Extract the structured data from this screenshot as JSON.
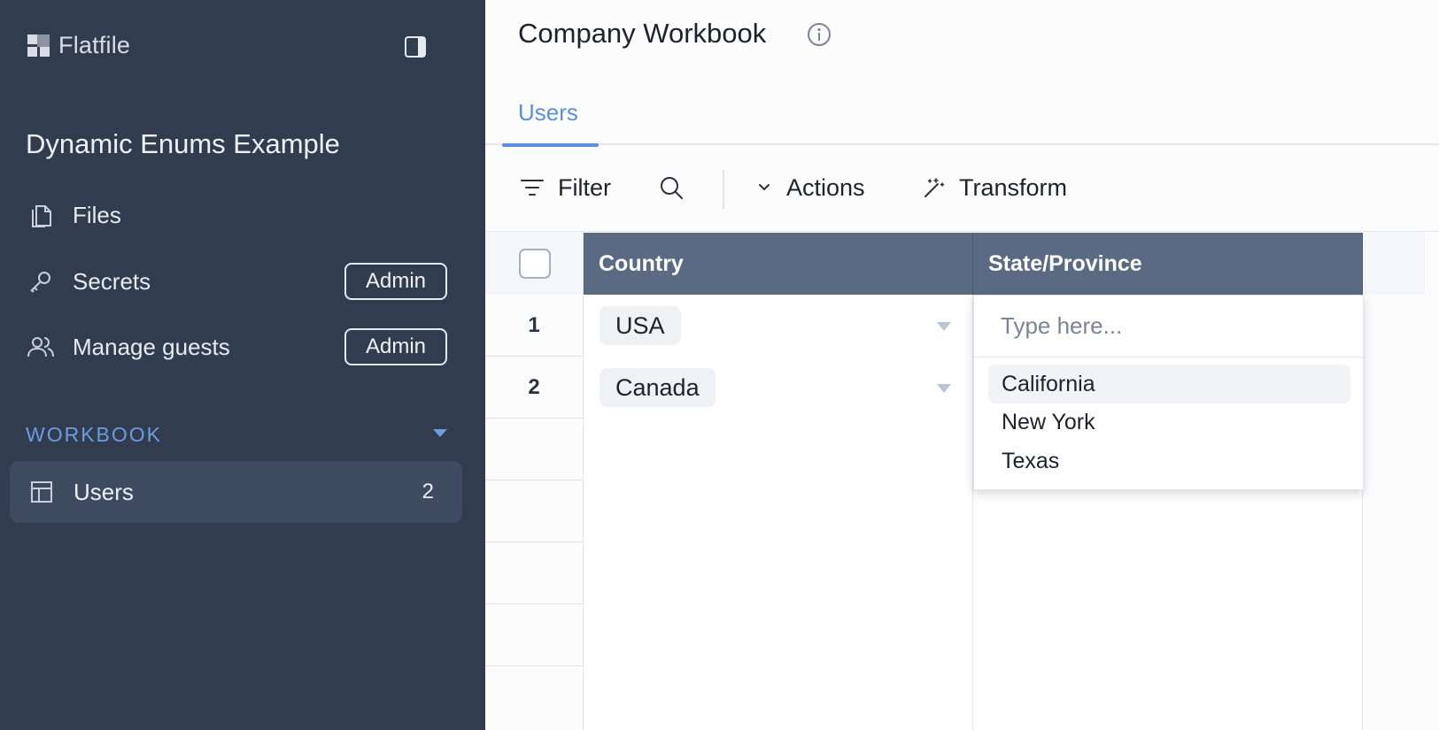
{
  "app": {
    "brand": "Flatfile"
  },
  "sidebar": {
    "space_title": "Dynamic Enums Example",
    "items": [
      {
        "label": "Files",
        "icon": "files-icon"
      },
      {
        "label": "Secrets",
        "icon": "key-icon",
        "badge": "Admin"
      },
      {
        "label": "Manage guests",
        "icon": "users-icon",
        "badge": "Admin"
      }
    ],
    "section": {
      "label": "WORKBOOK"
    },
    "sheets": [
      {
        "label": "Users",
        "count": "2",
        "icon": "table-icon"
      }
    ]
  },
  "workbook": {
    "title": "Company Workbook",
    "tabs": [
      {
        "label": "Users",
        "active": true
      }
    ]
  },
  "toolbar": {
    "filter_label": "Filter",
    "actions_label": "Actions",
    "transform_label": "Transform"
  },
  "grid": {
    "columns": [
      "Country",
      "State/Province"
    ],
    "rows": [
      {
        "num": "1",
        "country": "USA",
        "state": ""
      },
      {
        "num": "2",
        "country": "Canada",
        "state": ""
      }
    ]
  },
  "dropdown": {
    "placeholder": "Type here...",
    "options": [
      "California",
      "New York",
      "Texas"
    ],
    "highlighted": "California"
  },
  "colors": {
    "sidebar_bg": "#313d4f",
    "accent": "#5b8fd9",
    "header_bg": "#5b6a83"
  }
}
